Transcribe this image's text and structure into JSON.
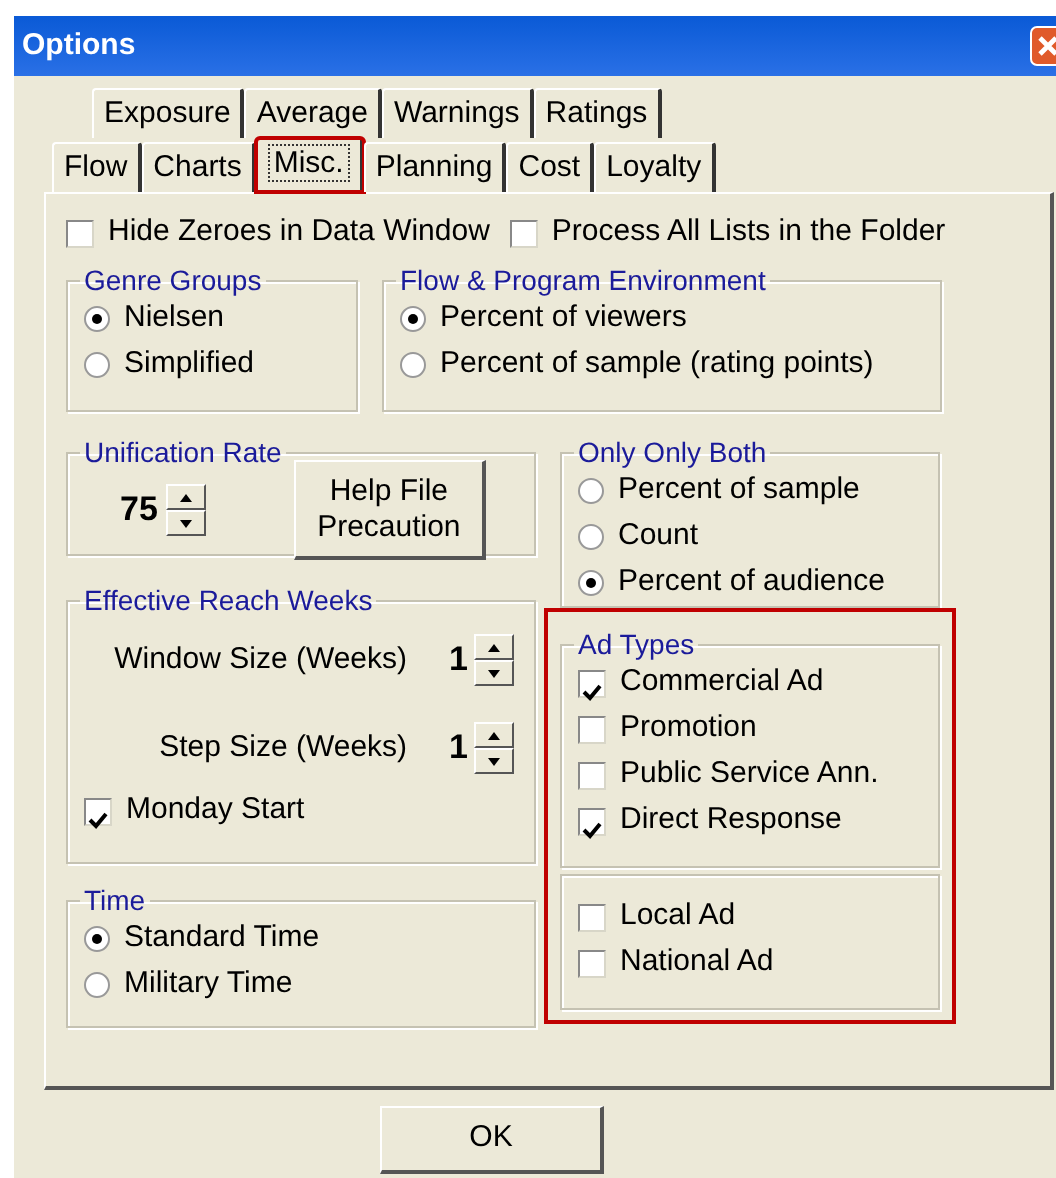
{
  "window": {
    "title": "Options"
  },
  "tabs": [
    [
      {
        "label": "Exposure",
        "selected": false,
        "highlighted": false
      },
      {
        "label": "Average",
        "selected": false,
        "highlighted": false
      },
      {
        "label": "Warnings",
        "selected": false,
        "highlighted": false
      },
      {
        "label": "Ratings",
        "selected": false,
        "highlighted": false
      }
    ],
    [
      {
        "label": "Flow",
        "selected": false,
        "highlighted": false
      },
      {
        "label": "Charts",
        "selected": false,
        "highlighted": false
      },
      {
        "label": "Misc.",
        "selected": true,
        "highlighted": true
      },
      {
        "label": "Planning",
        "selected": false,
        "highlighted": false
      },
      {
        "label": "Cost",
        "selected": false,
        "highlighted": false
      },
      {
        "label": "Loyalty",
        "selected": false,
        "highlighted": false
      }
    ]
  ],
  "options": [
    {
      "label": "Hide Zeroes in Data Window",
      "checked": false
    },
    {
      "label": "Process All Lists in the Folder",
      "checked": false
    }
  ],
  "genre_groups": {
    "title": "Genre Groups",
    "options": [
      {
        "label": "Nielsen",
        "selected": true
      },
      {
        "label": "Simplified",
        "selected": false
      }
    ]
  },
  "flow_program_environment": {
    "title": "Flow & Program Environment",
    "options": [
      {
        "label": "Percent of viewers",
        "selected": true
      },
      {
        "label": "Percent of sample (rating points)",
        "selected": false
      }
    ]
  },
  "unification_rate": {
    "title": "Unification Rate",
    "value": "75",
    "button": "Help File Precaution"
  },
  "effective_reach_weeks": {
    "title": "Effective Reach Weeks",
    "spinners": [
      {
        "label": "Window Size (Weeks)",
        "value": "1"
      },
      {
        "label": "Step Size (Weeks)",
        "value": "1"
      }
    ],
    "options": [
      {
        "label": "Monday Start",
        "checked": true
      }
    ]
  },
  "time": {
    "title": "Time",
    "options": [
      {
        "label": "Standard Time",
        "selected": true
      },
      {
        "label": "Military Time",
        "selected": false
      }
    ]
  },
  "only_only_both": {
    "title": "Only Only Both",
    "options": [
      {
        "label": "Percent of sample",
        "selected": false
      },
      {
        "label": "Count",
        "selected": false
      },
      {
        "label": "Percent of audience",
        "selected": true
      }
    ]
  },
  "ad_types": {
    "title": "Ad Types",
    "highlighted": true,
    "groups": [
      [
        {
          "label": "Commercial Ad",
          "checked": true
        },
        {
          "label": "Promotion",
          "checked": false
        },
        {
          "label": "Public Service Ann.",
          "checked": false
        },
        {
          "label": "Direct Response",
          "checked": true
        }
      ],
      [
        {
          "label": "Local Ad",
          "checked": false
        },
        {
          "label": "National Ad",
          "checked": false
        }
      ]
    ]
  },
  "buttons": [
    "OK"
  ]
}
